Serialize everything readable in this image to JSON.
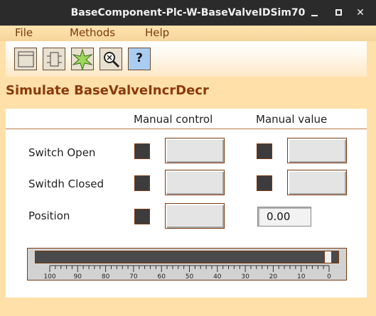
{
  "window": {
    "title": "BaseComponent-Plc-W-BaseValveIDSim70"
  },
  "menu": {
    "items": [
      "File",
      "Methods",
      "Help"
    ]
  },
  "toolbar": {
    "tools": [
      "graph-window-icon",
      "component-icon",
      "crosshair-star-icon",
      "zoom-icon",
      "help-icon"
    ],
    "help_label": "?"
  },
  "heading": "Simulate BaseValveIncrDecr",
  "columns": {
    "manual_control": "Manual control",
    "manual_value": "Manual value"
  },
  "rows": [
    {
      "label": "Switch Open"
    },
    {
      "label": "Switdh Closed"
    },
    {
      "label": "Position",
      "value": "0.00"
    }
  ],
  "slider": {
    "value": 0,
    "min": 0,
    "max": 100,
    "scale_labels": [
      "100",
      "90",
      "80",
      "70",
      "60",
      "50",
      "40",
      "30",
      "20",
      "10",
      "0"
    ]
  },
  "colors": {
    "background": "#ffe0a8",
    "accent": "#8a3a0c",
    "checkbox": "#3c3c3c"
  }
}
